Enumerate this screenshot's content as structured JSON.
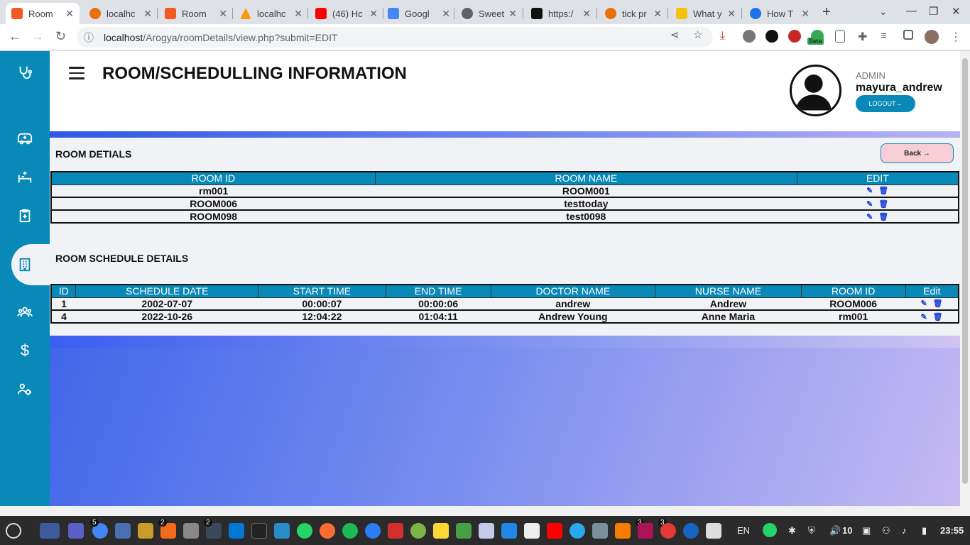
{
  "browser": {
    "tabs": [
      {
        "title": "Room",
        "active": true
      },
      {
        "title": "localhc"
      },
      {
        "title": "Room"
      },
      {
        "title": "localhc"
      },
      {
        "title": "(46) Hc"
      },
      {
        "title": "Googl"
      },
      {
        "title": "Sweet"
      },
      {
        "title": "https:/"
      },
      {
        "title": "tick pr"
      },
      {
        "title": "What y"
      },
      {
        "title": "How T"
      }
    ],
    "url_host": "localhost",
    "url_path": "/Arogya/roomDetails/view.php?submit=EDIT",
    "beta_badge": "Beta"
  },
  "header": {
    "title": "ROOM/SCHEDULLING INFORMATION",
    "role": "ADMIN",
    "username": "mayura_andrew",
    "logout_label": "LOGOUT→"
  },
  "rooms": {
    "title": "ROOM DETIALS",
    "back_label": "Back →",
    "columns": [
      "ROOM ID",
      "ROOM NAME",
      "EDIT"
    ],
    "rows": [
      {
        "room_id": "rm001",
        "room_name": "ROOM001"
      },
      {
        "room_id": "ROOM006",
        "room_name": "testtoday"
      },
      {
        "room_id": "ROOM098",
        "room_name": "test0098"
      }
    ]
  },
  "schedules": {
    "title": "ROOM SCHEDULE DETAILS",
    "columns": [
      "ID",
      "SCHEDULE DATE",
      "START TIME",
      "END TIME",
      "DOCTOR NAME",
      "NURSE NAME",
      "ROOM ID",
      "Edit"
    ],
    "rows": [
      {
        "id": "1",
        "date": "2002-07-07",
        "start": "00:00:07",
        "end": "00:00:06",
        "doctor": "andrew",
        "nurse": "Andrew",
        "room": "ROOM006"
      },
      {
        "id": "4",
        "date": "2022-10-26",
        "start": "12:04:22",
        "end": "01:04:11",
        "doctor": "Andrew Young",
        "nurse": "Anne Maria",
        "room": "rm001"
      }
    ]
  },
  "taskbar": {
    "badges": [
      "5",
      "2",
      "2",
      "3",
      "3"
    ],
    "lang": "EN",
    "volume": "10",
    "clock": "23:55"
  },
  "colors": {
    "sidebar": "#0889b8",
    "table_header": "#0889b8",
    "back_button": "#f7cdd6"
  }
}
